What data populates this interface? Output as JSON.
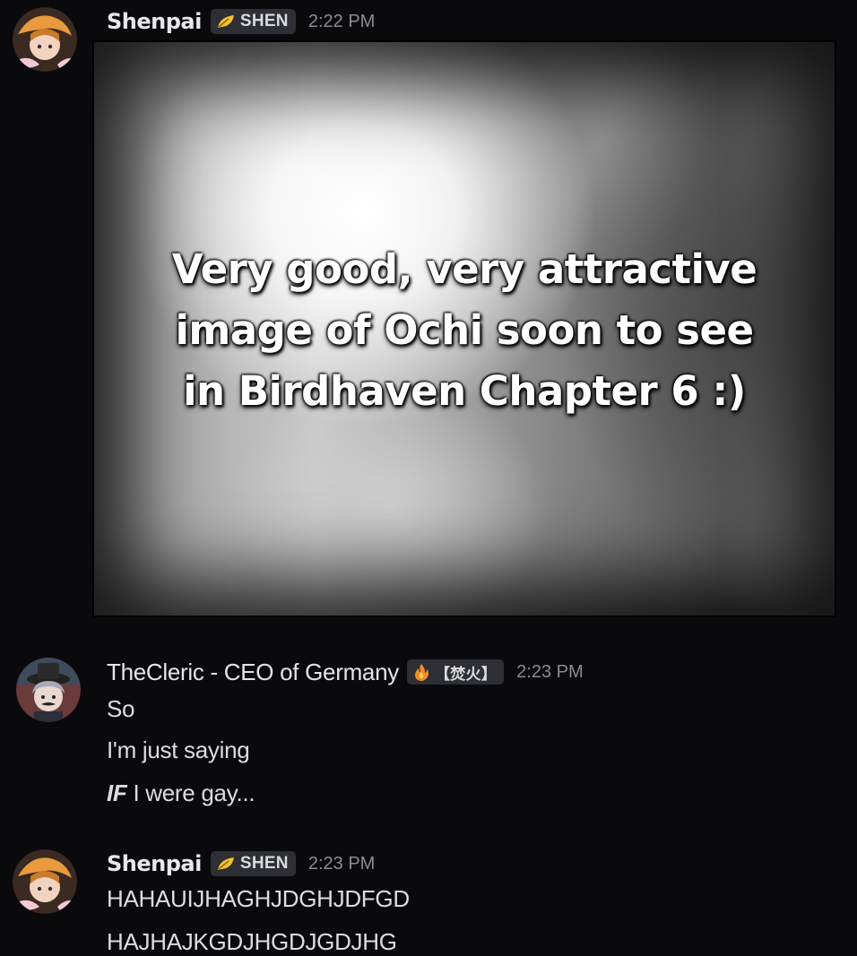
{
  "messages": [
    {
      "username": "Shenpai",
      "tag": "SHEN",
      "tag_icon": "leaf-icon",
      "timestamp": "2:22 PM",
      "embed_caption": "Very good, very attractive\nimage of Ochi soon to see\nin Birdhaven Chapter 6 :)"
    },
    {
      "username": "TheCleric - CEO of Germany",
      "tag": "【焚火】",
      "tag_icon": "fire-icon",
      "timestamp": "2:23 PM",
      "lines": [
        "So",
        "I'm just saying",
        "I were gay..."
      ],
      "emphasis_prefix": "IF"
    },
    {
      "username": "Shenpai",
      "tag": "SHEN",
      "tag_icon": "leaf-icon",
      "timestamp": "2:23 PM",
      "lines": [
        "HAHAUIJHAGHJDGHJDFGD",
        "HAJHAJKGDJHGDJGDJHG"
      ]
    }
  ],
  "colors": {
    "background": "#0a0a0d",
    "tag_background": "#2d2f34",
    "timestamp": "#8a8c93",
    "text": "#dcdde1"
  }
}
